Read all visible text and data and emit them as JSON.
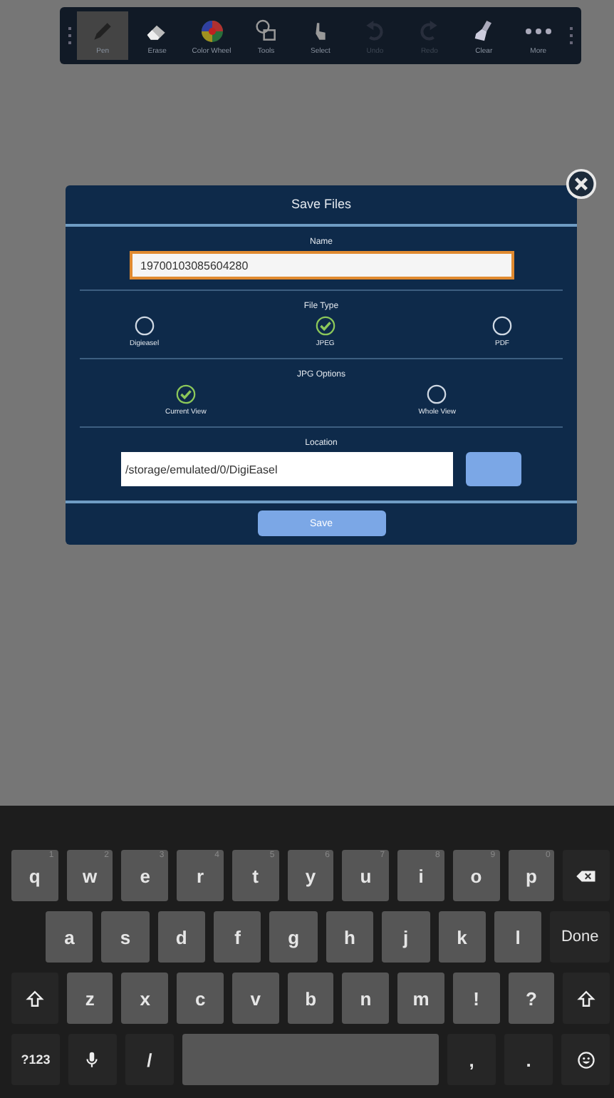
{
  "toolbar": {
    "items": [
      {
        "kind": "pen",
        "label": "Pen",
        "selected": true,
        "disabled": false
      },
      {
        "kind": "eraser",
        "label": "Erase",
        "selected": false,
        "disabled": false
      },
      {
        "kind": "wheel",
        "label": "Color Wheel",
        "selected": false,
        "disabled": false
      },
      {
        "kind": "tools",
        "label": "Tools",
        "selected": false,
        "disabled": false
      },
      {
        "kind": "select",
        "label": "Select",
        "selected": false,
        "disabled": false
      },
      {
        "kind": "undo",
        "label": "Undo",
        "selected": false,
        "disabled": true
      },
      {
        "kind": "redo",
        "label": "Redo",
        "selected": false,
        "disabled": true
      },
      {
        "kind": "clear",
        "label": "Clear",
        "selected": false,
        "disabled": false
      },
      {
        "kind": "more",
        "label": "More",
        "selected": false,
        "disabled": false
      }
    ]
  },
  "dialog": {
    "title": "Save Files",
    "name": {
      "label": "Name",
      "value": "19700103085604280"
    },
    "file_type": {
      "label": "File Type",
      "options": [
        {
          "label": "Digieasel",
          "selected": false
        },
        {
          "label": "JPEG",
          "selected": true
        },
        {
          "label": "PDF",
          "selected": false
        }
      ]
    },
    "jpg_options": {
      "label": "JPG Options",
      "options": [
        {
          "label": "Current View",
          "selected": true
        },
        {
          "label": "Whole View",
          "selected": false
        }
      ]
    },
    "location": {
      "label": "Location",
      "value": "/storage/emulated/0/DigiEasel"
    },
    "save_button": "Save"
  },
  "keyboard": {
    "rows": [
      {
        "keys": [
          {
            "kind": "letter",
            "label": "q",
            "hint": "1"
          },
          {
            "kind": "letter",
            "label": "w",
            "hint": "2"
          },
          {
            "kind": "letter",
            "label": "e",
            "hint": "3"
          },
          {
            "kind": "letter",
            "label": "r",
            "hint": "4"
          },
          {
            "kind": "letter",
            "label": "t",
            "hint": "5"
          },
          {
            "kind": "letter",
            "label": "y",
            "hint": "6"
          },
          {
            "kind": "letter",
            "label": "u",
            "hint": "7"
          },
          {
            "kind": "letter",
            "label": "i",
            "hint": "8"
          },
          {
            "kind": "letter",
            "label": "o",
            "hint": "9"
          },
          {
            "kind": "letter",
            "label": "p",
            "hint": "0"
          },
          {
            "kind": "backspace"
          }
        ]
      },
      {
        "keys": [
          {
            "kind": "letter",
            "label": "a"
          },
          {
            "kind": "letter",
            "label": "s"
          },
          {
            "kind": "letter",
            "label": "d"
          },
          {
            "kind": "letter",
            "label": "f"
          },
          {
            "kind": "letter",
            "label": "g"
          },
          {
            "kind": "letter",
            "label": "h"
          },
          {
            "kind": "letter",
            "label": "j"
          },
          {
            "kind": "letter",
            "label": "k"
          },
          {
            "kind": "letter",
            "label": "l"
          },
          {
            "kind": "done",
            "label": "Done"
          }
        ]
      },
      {
        "keys": [
          {
            "kind": "shift"
          },
          {
            "kind": "letter",
            "label": "z"
          },
          {
            "kind": "letter",
            "label": "x"
          },
          {
            "kind": "letter",
            "label": "c"
          },
          {
            "kind": "letter",
            "label": "v"
          },
          {
            "kind": "letter",
            "label": "b"
          },
          {
            "kind": "letter",
            "label": "n"
          },
          {
            "kind": "letter",
            "label": "m"
          },
          {
            "kind": "letter",
            "label": "!"
          },
          {
            "kind": "letter",
            "label": "?"
          },
          {
            "kind": "shift"
          }
        ]
      },
      {
        "keys": [
          {
            "kind": "symbols",
            "label": "?123"
          },
          {
            "kind": "mic"
          },
          {
            "kind": "function",
            "label": "/"
          },
          {
            "kind": "space"
          },
          {
            "kind": "function",
            "label": ","
          },
          {
            "kind": "function",
            "label": "."
          },
          {
            "kind": "emoji"
          }
        ]
      }
    ]
  }
}
